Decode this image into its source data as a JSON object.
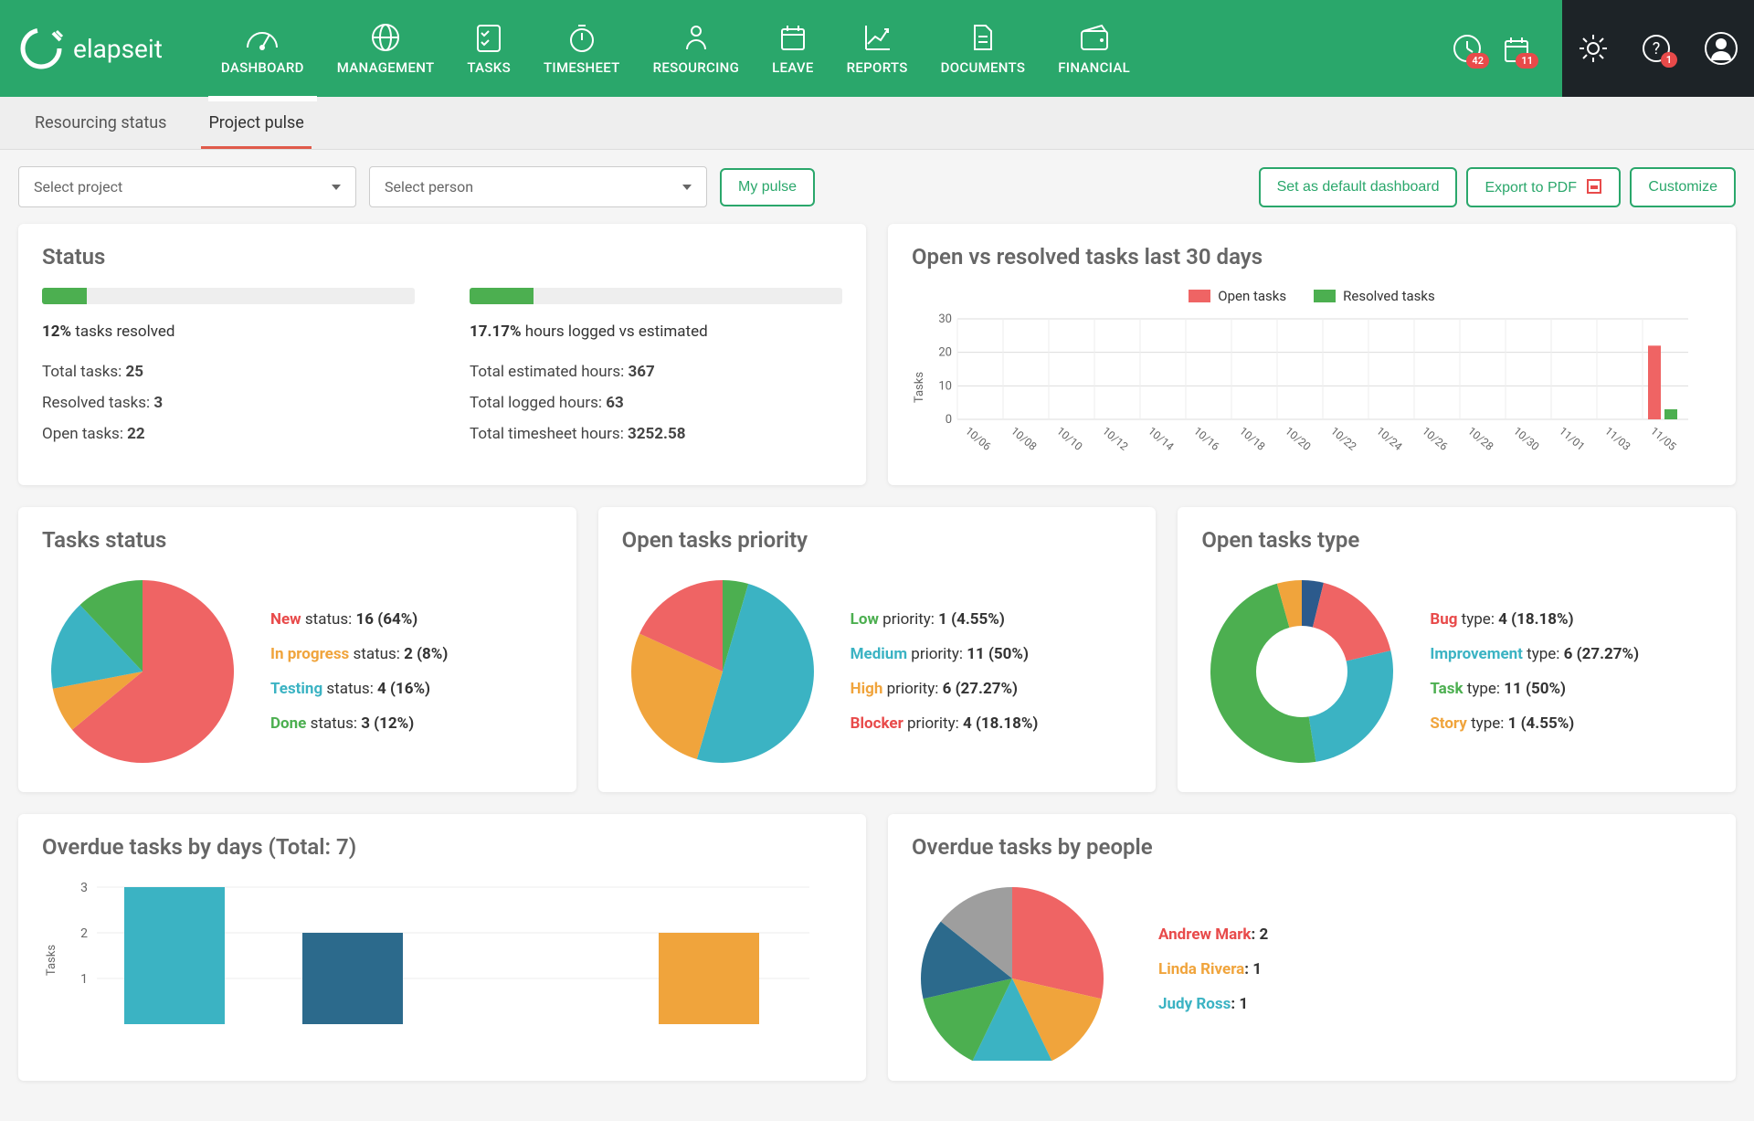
{
  "brand": "elapseit",
  "nav": [
    {
      "label": "DASHBOARD"
    },
    {
      "label": "MANAGEMENT"
    },
    {
      "label": "TASKS"
    },
    {
      "label": "TIMESHEET"
    },
    {
      "label": "RESOURCING"
    },
    {
      "label": "LEAVE"
    },
    {
      "label": "REPORTS"
    },
    {
      "label": "DOCUMENTS"
    },
    {
      "label": "FINANCIAL"
    }
  ],
  "badges": {
    "clock": "42",
    "calendar": "11",
    "help": "1"
  },
  "subtabs": {
    "resourcing": "Resourcing status",
    "pulse": "Project pulse"
  },
  "controls": {
    "select_project": "Select project",
    "select_person": "Select person",
    "my_pulse": "My pulse",
    "default_dash": "Set as default dashboard",
    "export_pdf": "Export to PDF",
    "customize": "Customize"
  },
  "status": {
    "title": "Status",
    "tasks": {
      "pct": 12,
      "pct_label": "12%",
      "suffix": " tasks resolved",
      "total_lbl": "Total tasks: ",
      "total": "25",
      "resolved_lbl": "Resolved tasks: ",
      "resolved": "3",
      "open_lbl": "Open tasks: ",
      "open": "22"
    },
    "hours": {
      "pct": 17.17,
      "pct_label": "17.17%",
      "suffix": " hours logged vs estimated",
      "est_lbl": "Total estimated hours: ",
      "est": "367",
      "logged_lbl": "Total logged hours: ",
      "logged": "63",
      "ts_lbl": "Total timesheet hours: ",
      "ts": "3252.58"
    }
  },
  "open_vs_resolved": {
    "title": "Open vs resolved tasks last 30 days",
    "legend_open": "Open tasks",
    "legend_resolved": "Resolved tasks",
    "ylabel": "Tasks"
  },
  "tasks_status": {
    "title": "Tasks status",
    "items": [
      {
        "color": "#e84a4a",
        "lbl": "New",
        "suffix": " status: ",
        "val": "16 (64%)"
      },
      {
        "color": "#f0a43c",
        "lbl": "In progress",
        "suffix": " status: ",
        "val": "2 (8%)"
      },
      {
        "color": "#3bb3c3",
        "lbl": "Testing",
        "suffix": " status: ",
        "val": "4 (16%)"
      },
      {
        "color": "#4caf50",
        "lbl": "Done",
        "suffix": " status: ",
        "val": "3 (12%)"
      }
    ]
  },
  "open_priority": {
    "title": "Open tasks priority",
    "items": [
      {
        "color": "#4caf50",
        "lbl": "Low",
        "suffix": " priority: ",
        "val": "1 (4.55%)"
      },
      {
        "color": "#3bb3c3",
        "lbl": "Medium",
        "suffix": " priority: ",
        "val": "11 (50%)"
      },
      {
        "color": "#f0a43c",
        "lbl": "High",
        "suffix": " priority: ",
        "val": "6 (27.27%)"
      },
      {
        "color": "#e84a4a",
        "lbl": "Blocker",
        "suffix": " priority: ",
        "val": "4 (18.18%)"
      }
    ]
  },
  "open_type": {
    "title": "Open tasks type",
    "items": [
      {
        "color": "#e84a4a",
        "lbl": "Bug",
        "suffix": " type: ",
        "val": "4 (18.18%)"
      },
      {
        "color": "#3bb3c3",
        "lbl": "Improvement",
        "suffix": " type: ",
        "val": "6 (27.27%)"
      },
      {
        "color": "#4caf50",
        "lbl": "Task",
        "suffix": " type: ",
        "val": "11 (50%)"
      },
      {
        "color": "#f0a43c",
        "lbl": "Story",
        "suffix": " type: ",
        "val": "1 (4.55%)"
      }
    ]
  },
  "overdue_days": {
    "title": "Overdue tasks by days (Total: 7)",
    "ylabel": "Tasks"
  },
  "overdue_people": {
    "title": "Overdue tasks by people",
    "items": [
      {
        "color": "#e84a4a",
        "lbl": "Andrew Mark",
        "val": ": 2"
      },
      {
        "color": "#f0a43c",
        "lbl": "Linda Rivera",
        "val": ": 1"
      },
      {
        "color": "#3bb3c3",
        "lbl": "Judy Ross",
        "val": ": 1"
      }
    ]
  },
  "chart_data": [
    {
      "id": "open_vs_resolved",
      "type": "bar",
      "categories": [
        "10/06",
        "10/08",
        "10/10",
        "10/12",
        "10/14",
        "10/16",
        "10/18",
        "10/20",
        "10/22",
        "10/24",
        "10/26",
        "10/28",
        "10/30",
        "11/01",
        "11/03",
        "11/05"
      ],
      "series": [
        {
          "name": "Open tasks",
          "color": "#ef6464",
          "values": [
            0,
            0,
            0,
            0,
            0,
            0,
            0,
            0,
            0,
            0,
            0,
            0,
            0,
            0,
            0,
            22
          ]
        },
        {
          "name": "Resolved tasks",
          "color": "#4caf50",
          "values": [
            0,
            0,
            0,
            0,
            0,
            0,
            0,
            0,
            0,
            0,
            0,
            0,
            0,
            0,
            0,
            3
          ]
        }
      ],
      "ylabel": "Tasks",
      "ylim": [
        0,
        30
      ],
      "yticks": [
        0,
        10,
        20,
        30
      ]
    },
    {
      "id": "tasks_status",
      "type": "pie",
      "slices": [
        {
          "label": "New",
          "value": 16,
          "pct": 64,
          "color": "#ef6464"
        },
        {
          "label": "In progress",
          "value": 2,
          "pct": 8,
          "color": "#f0a43c"
        },
        {
          "label": "Testing",
          "value": 4,
          "pct": 16,
          "color": "#3bb3c3"
        },
        {
          "label": "Done",
          "value": 3,
          "pct": 12,
          "color": "#4caf50"
        }
      ]
    },
    {
      "id": "open_priority",
      "type": "pie",
      "slices": [
        {
          "label": "Low",
          "value": 1,
          "pct": 4.55,
          "color": "#4caf50"
        },
        {
          "label": "Medium",
          "value": 11,
          "pct": 50,
          "color": "#3bb3c3"
        },
        {
          "label": "High",
          "value": 6,
          "pct": 27.27,
          "color": "#f0a43c"
        },
        {
          "label": "Blocker",
          "value": 4,
          "pct": 18.18,
          "color": "#ef6464"
        }
      ]
    },
    {
      "id": "open_type",
      "type": "donut",
      "slices": [
        {
          "label": "Bug",
          "value": 4,
          "pct": 18.18,
          "color": "#ef6464"
        },
        {
          "label": "Improvement",
          "value": 6,
          "pct": 27.27,
          "color": "#3bb3c3"
        },
        {
          "label": "Task",
          "value": 11,
          "pct": 50,
          "color": "#4caf50"
        },
        {
          "label": "Story",
          "value": 1,
          "pct": 4.55,
          "color": "#f0a43c"
        }
      ],
      "extra_slice": {
        "label": "",
        "pct": 0,
        "color": "#2c5a8c",
        "note": "small dark blue wedge visible at top"
      }
    },
    {
      "id": "overdue_days",
      "type": "bar",
      "categories": [
        "",
        "",
        "",
        ""
      ],
      "series": [
        {
          "name": "Overdue",
          "values": [
            3,
            2,
            0,
            2
          ],
          "colors": [
            "#3bb3c3",
            "#2c6a8c",
            "#2c6a8c",
            "#f0a43c"
          ]
        }
      ],
      "ylabel": "Tasks",
      "ylim": [
        0,
        3
      ],
      "yticks": [
        1,
        2,
        3
      ]
    },
    {
      "id": "overdue_people",
      "type": "pie",
      "slices": [
        {
          "label": "Andrew Mark",
          "value": 2,
          "color": "#ef6464"
        },
        {
          "label": "Linda Rivera",
          "value": 1,
          "color": "#f0a43c"
        },
        {
          "label": "Judy Ross",
          "value": 1,
          "color": "#3bb3c3"
        },
        {
          "label": "",
          "value": 1,
          "color": "#4caf50"
        },
        {
          "label": "",
          "value": 1,
          "color": "#2c6a8c"
        },
        {
          "label": "",
          "value": 1,
          "color": "#9e9e9e"
        }
      ]
    }
  ]
}
